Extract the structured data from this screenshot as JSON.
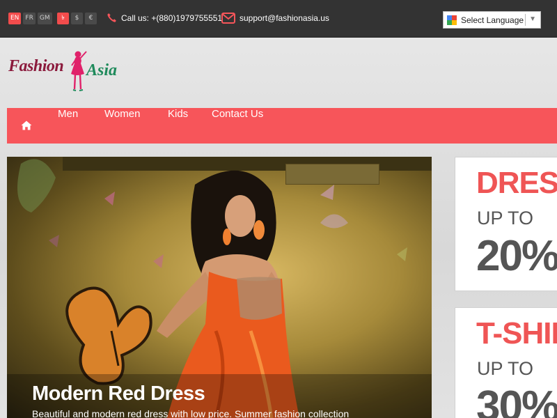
{
  "topbar": {
    "languages": [
      "EN",
      "FR",
      "GM"
    ],
    "active_language": "EN",
    "currencies": [
      "৳",
      "$",
      "€"
    ],
    "active_currency": "৳",
    "phone": "Call us: +(880)1979755551",
    "email": "support@fashionasia.us",
    "translate": {
      "label": "Select Language",
      "icon": "google-translate-icon",
      "arrow": "▼"
    }
  },
  "logo": {
    "text_part1": "Fashion",
    "text_part2": "Asia",
    "colors": {
      "primary": "#8b1a3c",
      "secondary": "#1f8a5b",
      "figure": "#e0226a"
    }
  },
  "nav": {
    "home_icon": "home-icon",
    "items": [
      "Men",
      "Women",
      "Kids",
      "Contact Us"
    ]
  },
  "slider": {
    "title": "Modern Red Dress",
    "description": "Beautiful and modern red dress with low price. Summer fashion collection"
  },
  "promos": [
    {
      "title": "DRESS",
      "subtitle": "UP TO",
      "discount": "20%"
    },
    {
      "title": "T-SHIRT",
      "subtitle": "UP TO",
      "discount": "30%"
    }
  ],
  "colors": {
    "accent": "#f7555a",
    "topbar": "#333333",
    "promo_title": "#ef5555"
  }
}
